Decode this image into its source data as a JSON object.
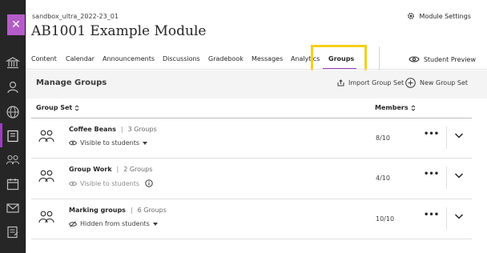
{
  "left_rail": {
    "icons": [
      "institution-icon",
      "profile-icon",
      "globe-icon",
      "courses-icon",
      "groups-icon",
      "calendar-icon",
      "messages-icon",
      "grades-icon"
    ]
  },
  "course": {
    "id": "sandbox_ultra_2022-23_01",
    "title": "AB1001 Example Module",
    "settings_label": "Module Settings"
  },
  "tabs": [
    {
      "label": "Content"
    },
    {
      "label": "Calendar"
    },
    {
      "label": "Announcements"
    },
    {
      "label": "Discussions"
    },
    {
      "label": "Gradebook"
    },
    {
      "label": "Messages"
    },
    {
      "label": "Analytics"
    },
    {
      "label": "Groups"
    }
  ],
  "active_tab": "Groups",
  "student_preview_label": "Student Preview",
  "manage": {
    "title": "Manage Groups",
    "import_label": "Import Group Set",
    "new_label": "New Group Set"
  },
  "columns": {
    "group_set": "Group Set",
    "members": "Members"
  },
  "groups": [
    {
      "name": "Coffee Beans",
      "count": "3 Groups",
      "visibility": "Visible to students",
      "members": "8/10"
    },
    {
      "name": "Group Work",
      "count": "2 Groups",
      "visibility": "Visible to students",
      "members": "4/10"
    },
    {
      "name": "Marking groups",
      "count": "6 Groups",
      "visibility": "Hidden from students",
      "members": "10/10"
    }
  ],
  "colors": {
    "accent": "#9b3fbf",
    "highlight": "#f5d016",
    "rail": "#262626"
  }
}
